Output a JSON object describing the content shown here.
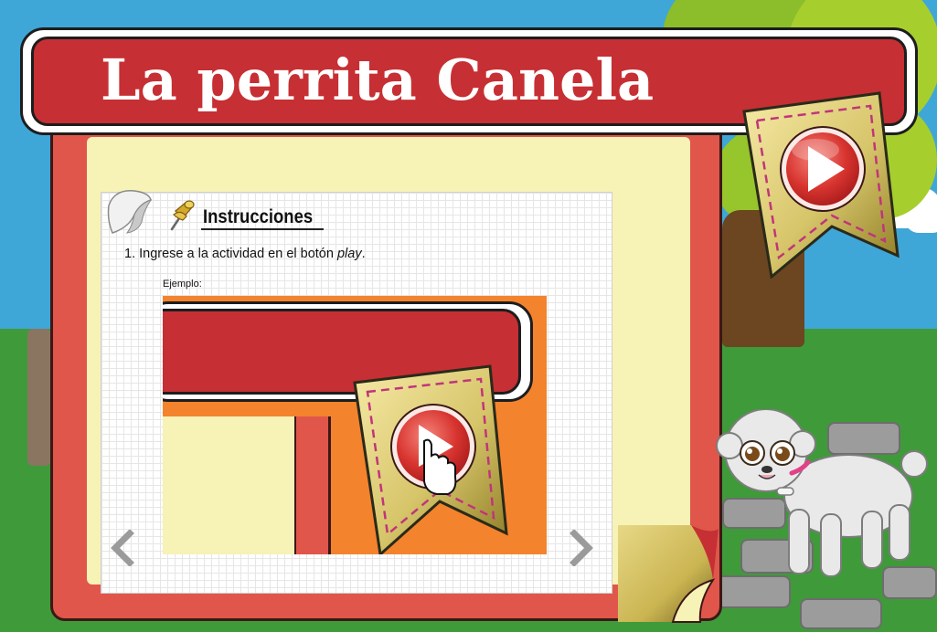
{
  "app": {
    "title": "La perrita Canela"
  },
  "play_button": {
    "icon": "play-icon",
    "accent_color": "#c62f33"
  },
  "instructions": {
    "heading": "Instrucciones",
    "step_number": "1.",
    "step_text_before": "Ingrese a la actividad en el botón ",
    "step_text_emphasis": "play",
    "step_text_after": ".",
    "example_label": "Ejemplo:"
  },
  "navigation": {
    "prev_icon": "chevron-left-icon",
    "next_icon": "chevron-right-icon"
  },
  "colors": {
    "frame_red": "#e0564a",
    "title_red": "#c62f33",
    "panel_yellow": "#f7f2b6",
    "ribbon_gold": "#d7c56a",
    "sky_blue": "#3fa6d8",
    "grass_green": "#3f9a3a"
  }
}
